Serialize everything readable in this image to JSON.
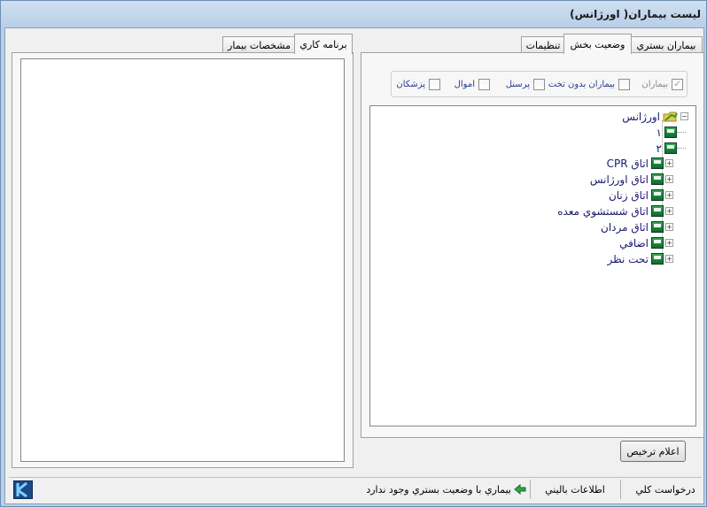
{
  "window": {
    "title": "ليست بيماران( اورژانس)"
  },
  "right_tabs": [
    {
      "label": "بيماران بستري",
      "active": false
    },
    {
      "label": "وضعيت بخش",
      "active": true
    },
    {
      "label": "تنظيمات",
      "active": false
    }
  ],
  "filters": [
    {
      "label": "بيماران",
      "checked": true,
      "disabled": true
    },
    {
      "label": "بيماران بدون تخت",
      "checked": false,
      "disabled": false
    },
    {
      "label": "پرسنل",
      "checked": false,
      "disabled": false
    },
    {
      "label": "اموال",
      "checked": false,
      "disabled": false
    },
    {
      "label": "پزشكان",
      "checked": false,
      "disabled": false
    }
  ],
  "tree": {
    "root": {
      "label": "اورژانس",
      "expanded": true,
      "icon": "folder-icon"
    },
    "children": [
      {
        "label": "١",
        "expandable": false,
        "icon": "bed-icon"
      },
      {
        "label": "٢",
        "expandable": false,
        "icon": "bed-icon"
      },
      {
        "label": "اتاق CPR",
        "expandable": true,
        "icon": "bed-icon"
      },
      {
        "label": "اتاق اورژانس",
        "expandable": true,
        "icon": "bed-icon"
      },
      {
        "label": "اتاق زنان",
        "expandable": true,
        "icon": "bed-icon"
      },
      {
        "label": "اتاق شستشوي معده",
        "expandable": true,
        "icon": "bed-icon"
      },
      {
        "label": "اتاق مردان",
        "expandable": true,
        "icon": "bed-icon"
      },
      {
        "label": "اضافي",
        "expandable": true,
        "icon": "bed-icon"
      },
      {
        "label": "تحت نظر",
        "expandable": true,
        "icon": "bed-icon"
      }
    ]
  },
  "discharge_button": "اعلام ترخيص",
  "left_tabs": [
    {
      "label": "برنامه كاري",
      "active": true
    },
    {
      "label": "مشخصات بيمار",
      "active": false
    }
  ],
  "status": {
    "general_request": "درخواست كلي",
    "clinical_info": "اطلاعات باليني",
    "message": "بيماري با وضعيت بستري وجود ندارد"
  },
  "colors": {
    "tree_text": "#1a1a6e",
    "filter_text": "#2a3c8f",
    "bed_icon": "#1f8a40"
  }
}
